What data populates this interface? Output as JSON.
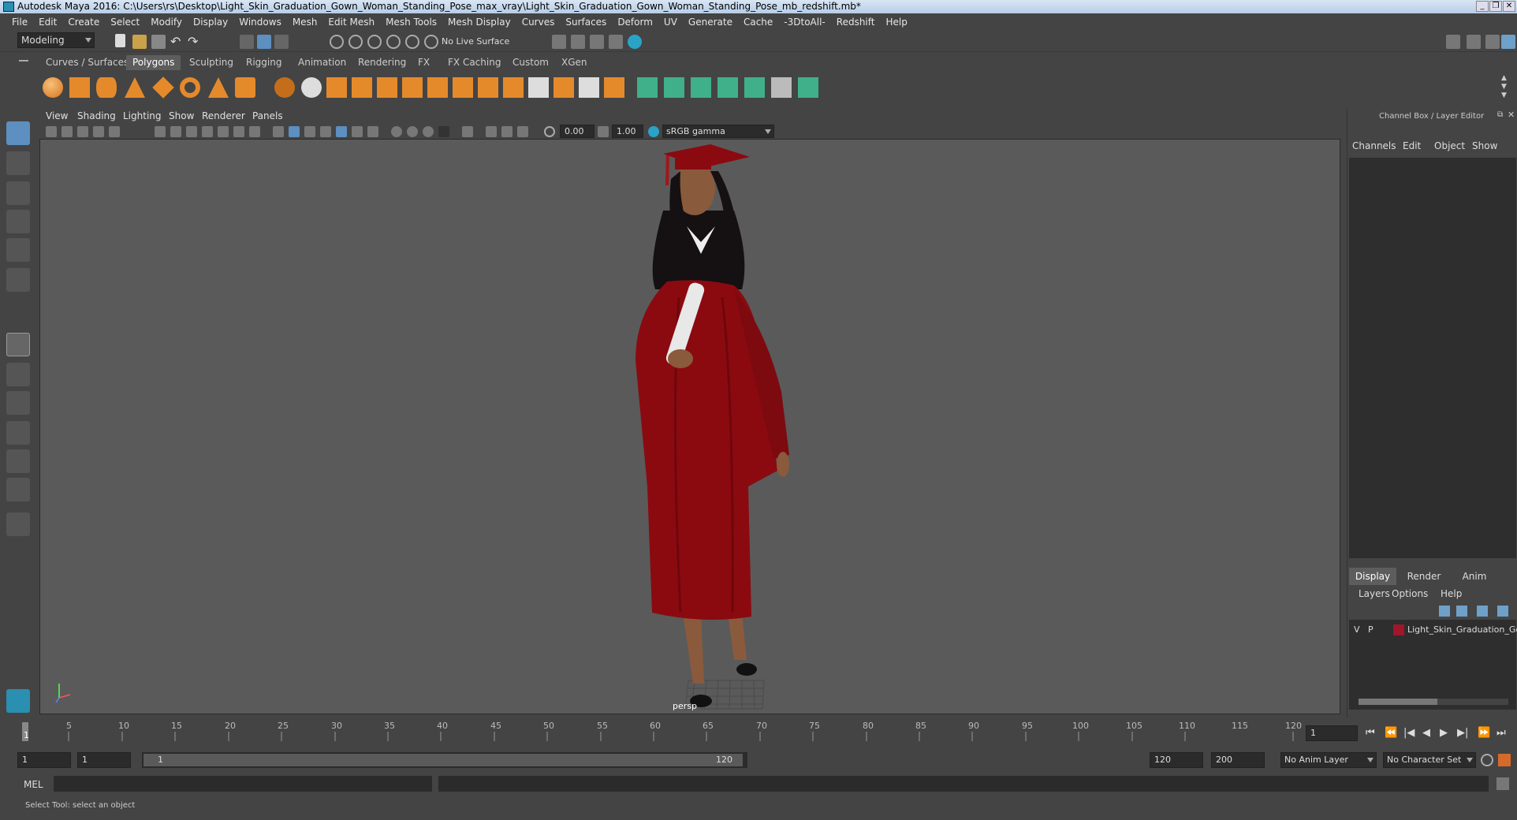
{
  "window": {
    "title": "Autodesk Maya 2016: C:\\Users\\rs\\Desktop\\Light_Skin_Graduation_Gown_Woman_Standing_Pose_max_vray\\Light_Skin_Graduation_Gown_Woman_Standing_Pose_mb_redshift.mb*"
  },
  "menubar": [
    "File",
    "Edit",
    "Create",
    "Select",
    "Modify",
    "Display",
    "Windows",
    "Mesh",
    "Edit Mesh",
    "Mesh Tools",
    "Mesh Display",
    "Curves",
    "Surfaces",
    "Deform",
    "UV",
    "Generate",
    "Cache",
    "-3DtoAll-",
    "Redshift",
    "Help"
  ],
  "statusline": {
    "mode": "Modeling",
    "live_surface": "No Live Surface"
  },
  "shelf_tabs": [
    "Curves / Surfaces",
    "Polygons",
    "Sculpting",
    "Rigging",
    "Animation",
    "Rendering",
    "FX",
    "FX Caching",
    "Custom",
    "XGen"
  ],
  "shelf_active": "Polygons",
  "viewport": {
    "menu": [
      "View",
      "Shading",
      "Lighting",
      "Show",
      "Renderer",
      "Panels"
    ],
    "exposure": "0.00",
    "gamma": "1.00",
    "colorspace": "sRGB gamma",
    "camera_label": "persp"
  },
  "channel_box": {
    "title": "Channel Box / Layer Editor",
    "menu": [
      "Channels",
      "Edit",
      "Object",
      "Show"
    ]
  },
  "layer_editor": {
    "tabs": [
      "Display",
      "Render",
      "Anim"
    ],
    "menu": [
      "Layers",
      "Options",
      "Help"
    ],
    "layer": {
      "v": "V",
      "p": "P",
      "name": "Light_Skin_Graduation_Go",
      "color": "#a0162a"
    }
  },
  "timeline": {
    "ticks": [
      "5",
      "10",
      "15",
      "20",
      "25",
      "30",
      "35",
      "40",
      "45",
      "50",
      "55",
      "60",
      "65",
      "70",
      "75",
      "80",
      "85",
      "90",
      "95",
      "100",
      "105",
      "110",
      "115",
      "120"
    ],
    "first_tick": "1",
    "current_frame": "1"
  },
  "range": {
    "start": "1",
    "playback_start": "1",
    "slider_start": "1",
    "slider_end": "120",
    "playback_end": "120",
    "end": "200",
    "anim_layer": "No Anim Layer",
    "character_set": "No Character Set"
  },
  "cmdline": {
    "label": "MEL"
  },
  "helpline": {
    "text": "Select Tool: select an object"
  }
}
